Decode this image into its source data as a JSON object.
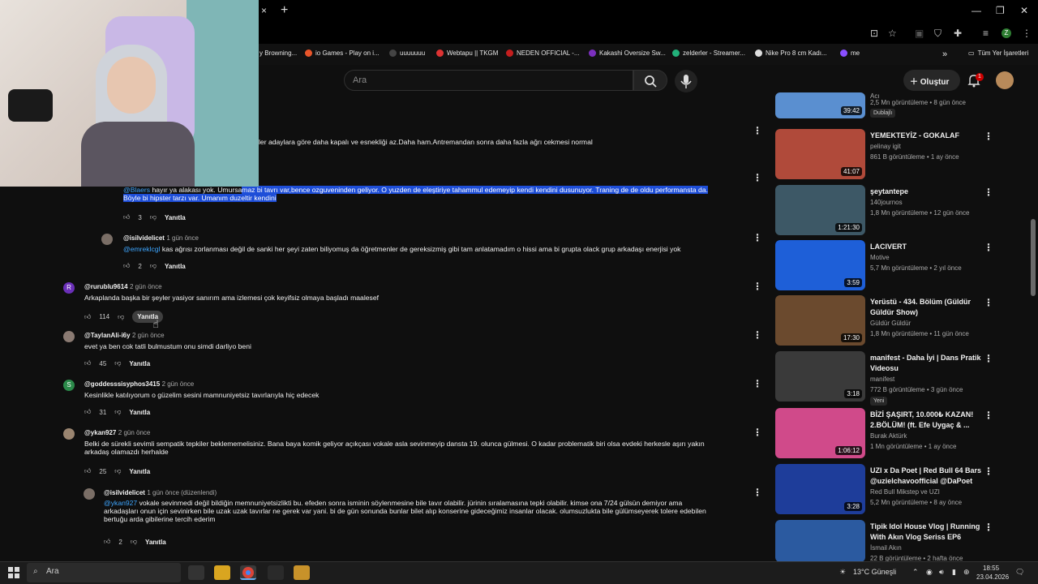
{
  "browser": {
    "close_tab": "×",
    "new_tab": "+",
    "window_controls": [
      "—",
      "❐",
      "✕"
    ],
    "profile_letter": "Z",
    "bookmarks": [
      {
        "label": "y Browning...",
        "color": ""
      },
      {
        "label": "io Games - Play on i...",
        "color": "#e8552a"
      },
      {
        "label": "uuuuuuu",
        "color": "#444"
      },
      {
        "label": "Webtapu || TKGM",
        "color": "#d33"
      },
      {
        "label": "NEDEN OFFICIAL -...",
        "color": "#c41e1e"
      },
      {
        "label": "Kakashi Oversize Sw...",
        "color": "#7b2fbe"
      },
      {
        "label": "zelderler - Streamer...",
        "color": "#22b07a"
      },
      {
        "label": "Nike Pro 8 cm Kadı...",
        "color": "#ddd"
      },
      {
        "label": "me",
        "color": "#8a4fff"
      }
    ],
    "bookmarks_more": "»",
    "all_bookmarks": "Tüm Yer İşaretleri"
  },
  "youtube": {
    "search_placeholder": "Ara",
    "create_label": "Oluştur",
    "notification_count": "1"
  },
  "comments": [
    {
      "id": "c0",
      "text": "ler adaylara göre daha kapalı ve esnekliği az.Daha ham.Antremandan sonra daha fazla ağrı cekmesi normal"
    },
    {
      "id": "c1",
      "author": "",
      "mention": "@Blaers",
      "text_before": "hayır ya alakası yok. Umursa",
      "text_sel": "maz bi tavrı var,bence ozguveninden geliyor. O yuzden de eleştiriye tahammul edemeyip kendi kendini dusunuyor. Traning de de oldu performansta da.",
      "text2": "Böyle bi hipster tarzı var. Umanım duzeltir kendini",
      "likes": "3",
      "reply": "Yanıtla"
    },
    {
      "id": "c2",
      "author": "@isilvidelicet",
      "time": "1 gün önce",
      "mention": "@emreklcgl",
      "text": "kas ağrısı zorlanması değil de sanki her şeyi zaten biliyomuş da öğretmenler de gereksizmiş gibi tam anlatamadım o hissi ama bi grupta olack grup arkadaşı enerjisi yok",
      "likes": "2",
      "reply": "Yanıtla"
    },
    {
      "id": "c3",
      "author": "@rurublu9614",
      "time": "2 gün önce",
      "initial": "R",
      "text": "Arkaplanda başka bir şeyler yasiyor sanırım ama izlemesi çok keyifsiz olmaya başladı maalesef",
      "likes": "114",
      "reply": "Yanıtla"
    },
    {
      "id": "c4",
      "author": "@TaylanAli-i6y",
      "time": "2 gün önce",
      "text": "evet ya ben cok tatli bulmustum onu simdi darliyo beni",
      "likes": "45",
      "reply": "Yanıtla"
    },
    {
      "id": "c5",
      "author": "@goddesssisyphos3415",
      "time": "2 gün önce",
      "initial": "S",
      "text": "Kesinlikle katılıyorum o güzelim sesini mamnuniyetsiz tavırlarıyla hiç edecek",
      "likes": "31",
      "reply": "Yanıtla"
    },
    {
      "id": "c6",
      "author": "@ykan927",
      "time": "2 gün önce",
      "text": "Belki de sürekli sevimli sempatik tepkiler beklememelisiniz. Bana baya komik geliyor açıkçası vokale asla sevinmeyip dansta 19. olunca gülmesi. O kadar problematik biri olsa evdeki herkesle aşırı yakın",
      "text2": "arkadaş olamazdı herhalde",
      "likes": "25",
      "reply": "Yanıtla"
    },
    {
      "id": "c7",
      "author": "@isilvidelicet",
      "time": "1 gün önce (düzenlendi)",
      "mention": "@ykan927",
      "text": "vokale sevinmedi değil bildiğin memnuniyetsizlikti bu. efeden sonra isminin söylenmesine bile tavır olabilir. jürinin sıralamasına tepki olabilir. kimse ona 7/24 gülsün demiyor ama",
      "text2": "arkadaşları onun için sevinirken bile uzak uzak tavırlar ne gerek var yani. bi de gün sonunda bunlar bilet alıp konserine gideceğimiz insanlar olacak. olumsuzlukta bile gülümseyerek tolere edebilen",
      "text3": "bertuğu arda gibilerine tercih ederim",
      "likes": "2",
      "reply": "Yanıtla"
    }
  ],
  "videos": [
    {
      "title": "",
      "channel": "Acı",
      "meta": "2,5 Mn görüntüleme • 8 gün önce",
      "duration": "39:42",
      "tag": "Dublajlı",
      "color": "#5a8fd0"
    },
    {
      "title": "YEMEKTEYİZ - GOKALAF",
      "channel": "pelinay igit",
      "meta": "861 B görüntüleme • 1 ay önce",
      "duration": "41:07",
      "color": "#b04a3a"
    },
    {
      "title": "şeytantepe",
      "channel": "140journos",
      "meta": "1,8 Mn görüntüleme • 12 gün önce",
      "duration": "1:21:30",
      "color": "#3d5866"
    },
    {
      "title": "LACIVERT",
      "channel": "Motive",
      "meta": "5,7 Mn görüntüleme • 2 yıl önce",
      "duration": "3:59",
      "color": "#1e5fd8"
    },
    {
      "title": "Yerüstü - 434. Bölüm (Güldür Güldür Show)",
      "channel": "Güldür Güldür",
      "meta": "1,8 Mn görüntüleme • 11 gün önce",
      "duration": "17:30",
      "color": "#6b4a2e"
    },
    {
      "title": "manifest - Daha İyi | Dans Pratik Videosu",
      "channel": "manifest",
      "meta": "772 B görüntüleme • 3 gün önce",
      "duration": "3:18",
      "tag": "Yeni",
      "color": "#3a3a3a"
    },
    {
      "title": "BİZİ ŞAŞIRT, 10.000₺ KAZAN! 2.BÖLÜM! (ft. Efe Uygaç & ...",
      "channel": "Burak Aktürk",
      "meta": "1 Mn görüntüleme • 1 ay önce",
      "duration": "1:06:12",
      "color": "#d04a8a"
    },
    {
      "title": "UZI x Da Poet | Red Bull 64 Bars @uzielchavoofficial @DaPoet",
      "channel": "Red Bull Mikstep ve UZI",
      "meta": "5,2 Mn görüntüleme • 8 ay önce",
      "duration": "3:28",
      "color": "#1e3d9a"
    },
    {
      "title": "Tipik Idol House Vlog | Running With Akın Vlog Seriss EP6",
      "channel": "İsmail Akın",
      "meta": "22 B görüntüleme • 2 hafta önce",
      "duration": "",
      "color": "#2b5aa0"
    }
  ],
  "taskbar": {
    "search": "Ara",
    "weather": "13°C Güneşli",
    "time": "18:55",
    "date": "23.04.2026",
    "notif": "1"
  }
}
